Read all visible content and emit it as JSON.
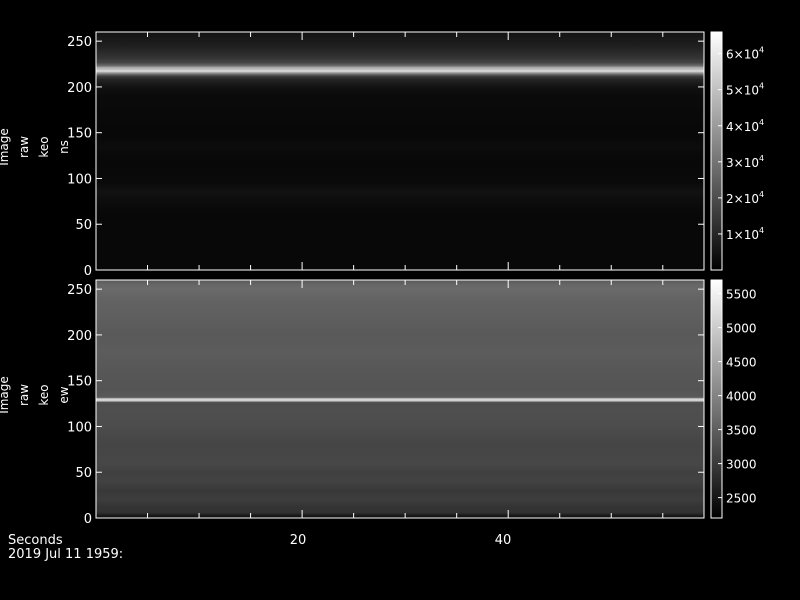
{
  "colors": {
    "background": "#000000",
    "foreground": "#ffffff"
  },
  "footer": {
    "xlabel": "Seconds",
    "date": "2019 Jul 11 1959:",
    "xticks": [
      "20",
      "40"
    ]
  },
  "chart_data": [
    {
      "type": "heatmap",
      "ylabel_lines": [
        "Image",
        "raw",
        "keo",
        "ns"
      ],
      "x_range": [
        0,
        59
      ],
      "ylim": [
        0,
        260
      ],
      "yticks": [
        0,
        50,
        100,
        150,
        200,
        250
      ],
      "xticks": [
        20,
        40
      ],
      "colorbar": {
        "range": [
          0,
          66000
        ],
        "ticks": [
          {
            "value": 10000,
            "mantissa": "1",
            "exponent": "4"
          },
          {
            "value": 20000,
            "mantissa": "2",
            "exponent": "4"
          },
          {
            "value": 30000,
            "mantissa": "3",
            "exponent": "4"
          },
          {
            "value": 40000,
            "mantissa": "4",
            "exponent": "4"
          },
          {
            "value": 50000,
            "mantissa": "5",
            "exponent": "4"
          },
          {
            "value": 60000,
            "mantissa": "6",
            "exponent": "4"
          }
        ]
      },
      "profile": [
        [
          0,
          0.03
        ],
        [
          60,
          0.03
        ],
        [
          75,
          0.05
        ],
        [
          85,
          0.07
        ],
        [
          95,
          0.04
        ],
        [
          120,
          0.03
        ],
        [
          135,
          0.05
        ],
        [
          145,
          0.03
        ],
        [
          190,
          0.04
        ],
        [
          200,
          0.07
        ],
        [
          208,
          0.14
        ],
        [
          212,
          0.25
        ],
        [
          215,
          0.55
        ],
        [
          217,
          0.85
        ],
        [
          218,
          0.95
        ],
        [
          219,
          0.72
        ],
        [
          220,
          0.88
        ],
        [
          222,
          0.5
        ],
        [
          226,
          0.28
        ],
        [
          232,
          0.2
        ],
        [
          245,
          0.12
        ],
        [
          255,
          0.09
        ],
        [
          260,
          0.07
        ]
      ]
    },
    {
      "type": "heatmap",
      "ylabel_lines": [
        "Image",
        "raw",
        "keo",
        "ew"
      ],
      "x_range": [
        0,
        59
      ],
      "ylim": [
        0,
        260
      ],
      "yticks": [
        0,
        50,
        100,
        150,
        200,
        250
      ],
      "xticks": [
        20,
        40
      ],
      "colorbar": {
        "range": [
          2200,
          5700
        ],
        "ticks": [
          {
            "value": 2500,
            "label": "2500"
          },
          {
            "value": 3000,
            "label": "3000"
          },
          {
            "value": 3500,
            "label": "3500"
          },
          {
            "value": 4000,
            "label": "4000"
          },
          {
            "value": 4500,
            "label": "4500"
          },
          {
            "value": 5000,
            "label": "5000"
          },
          {
            "value": 5500,
            "label": "5500"
          }
        ]
      },
      "profile": [
        [
          0,
          0.05
        ],
        [
          3,
          0.1
        ],
        [
          6,
          0.2
        ],
        [
          12,
          0.2
        ],
        [
          20,
          0.24
        ],
        [
          30,
          0.22
        ],
        [
          40,
          0.26
        ],
        [
          50,
          0.25
        ],
        [
          60,
          0.28
        ],
        [
          80,
          0.27
        ],
        [
          100,
          0.3
        ],
        [
          120,
          0.31
        ],
        [
          127,
          0.3
        ],
        [
          128,
          0.8
        ],
        [
          129,
          0.95
        ],
        [
          130,
          0.85
        ],
        [
          131,
          0.35
        ],
        [
          140,
          0.33
        ],
        [
          160,
          0.34
        ],
        [
          180,
          0.36
        ],
        [
          200,
          0.35
        ],
        [
          220,
          0.37
        ],
        [
          240,
          0.39
        ],
        [
          250,
          0.42
        ],
        [
          255,
          0.4
        ],
        [
          260,
          0.35
        ]
      ]
    }
  ]
}
